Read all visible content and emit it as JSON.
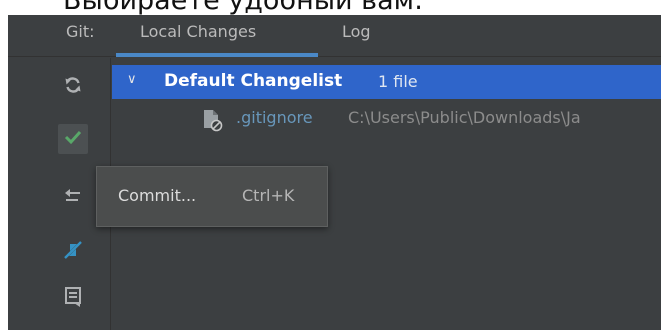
{
  "top_text": "Выбираете удобный вам:",
  "panel": {
    "git_label": "Git:",
    "tabs": [
      {
        "label": "Local Changes",
        "active": true
      },
      {
        "label": "Log",
        "active": false
      }
    ]
  },
  "toolbar": {
    "icons": [
      "refresh-icon",
      "commit-check-icon",
      "rollback-icon",
      "diff-arrows-icon",
      "shelf-icon"
    ]
  },
  "changelist": {
    "name": "Default Changelist",
    "count": "1 file",
    "files": [
      {
        "name": ".gitignore",
        "path": "C:\\Users\\Public\\Downloads\\Ja"
      }
    ]
  },
  "tooltip": {
    "label": "Commit...",
    "shortcut": "Ctrl+K"
  },
  "colors": {
    "background": "#3c3f41",
    "selection": "#2f65ca",
    "accent_underline": "#4a88c7",
    "commit_green": "#59a869",
    "diff_blue": "#3592c4",
    "file_blue": "#6897bb"
  }
}
